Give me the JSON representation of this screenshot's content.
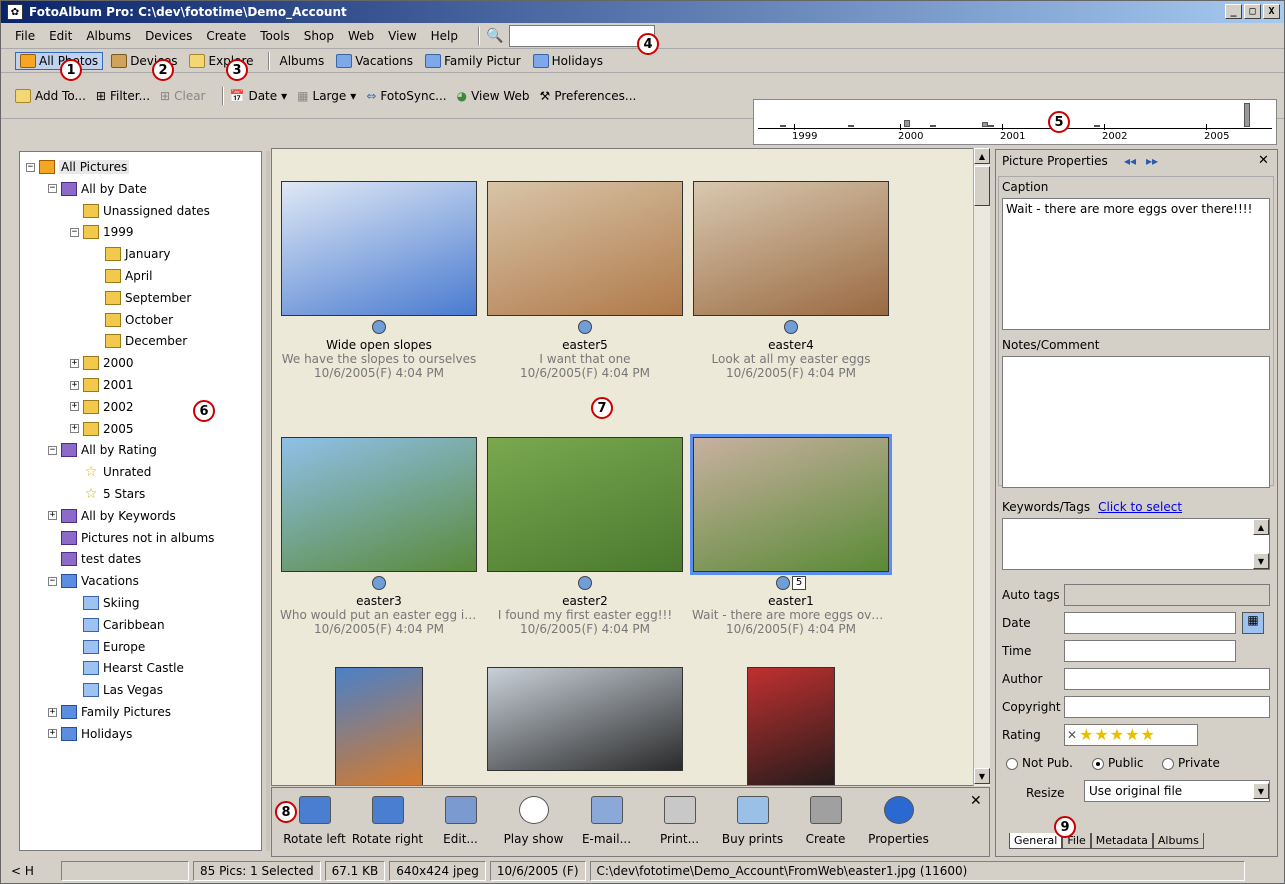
{
  "window": {
    "title": "FotoAlbum Pro:  C:\\dev\\fototime\\Demo_Account",
    "minimize": "_",
    "maximize": "□",
    "close": "X"
  },
  "menu": [
    "File",
    "Edit",
    "Albums",
    "Devices",
    "Create",
    "Tools",
    "Shop",
    "Web",
    "View",
    "Help"
  ],
  "search": {
    "value": "",
    "placeholder": ""
  },
  "nav": {
    "all_photos": "All Photos",
    "devices": "Devices",
    "explore": "Explore",
    "albums": "Albums",
    "vacations": "Vacations",
    "family": "Family Pictur",
    "holidays": "Holidays"
  },
  "toolbar": {
    "add_to": "Add To...",
    "filter": "Filter...",
    "clear": "Clear",
    "date": "Date",
    "large": "Large",
    "fotosync": "FotoSync...",
    "view_web": "View Web",
    "preferences": "Preferences..."
  },
  "timeline": {
    "years": [
      "1999",
      "2000",
      "2001",
      "2002",
      "2005"
    ],
    "bar_levels": [
      0.1,
      0.1,
      0.3,
      0.1,
      0.2,
      0.1,
      0.1,
      1.0
    ]
  },
  "tree": {
    "root": "All Pictures",
    "by_date": "All by Date",
    "unassigned": "Unassigned dates",
    "y1999": "1999",
    "months": [
      "January",
      "April",
      "September",
      "October",
      "December"
    ],
    "y2000": "2000",
    "y2001": "2001",
    "y2002": "2002",
    "y2005": "2005",
    "by_rating": "All by Rating",
    "unrated": "Unrated",
    "five_stars": "5 Stars",
    "by_keywords": "All by Keywords",
    "not_in_albums": "Pictures not in albums",
    "test_dates": "test dates",
    "vacations": "Vacations",
    "vacation_items": [
      "Skiing",
      "Caribbean",
      "Europe",
      "Hearst Castle",
      "Las Vegas"
    ],
    "family": "Family Pictures",
    "holidays": "Holidays"
  },
  "photos": [
    {
      "caption": "Wide open slopes",
      "desc": "We have the slopes to ourselves",
      "date": "10/6/2005(F)  4:04 PM",
      "colors": [
        "#4a7bd0",
        "#dfe8f5"
      ]
    },
    {
      "caption": "easter5",
      "desc": "I want that one",
      "date": "10/6/2005(F)  4:04 PM",
      "colors": [
        "#b07a4a",
        "#d8c4a8"
      ]
    },
    {
      "caption": "easter4",
      "desc": "Look at all my easter eggs",
      "date": "10/6/2005(F)  4:04 PM",
      "colors": [
        "#9a6a42",
        "#d8c8b0"
      ]
    },
    {
      "caption": "easter3",
      "desc": "Who would put an easter egg in ...",
      "date": "10/6/2005(F)  4:04 PM",
      "colors": [
        "#5a8a3a",
        "#8fc0e8"
      ]
    },
    {
      "caption": "easter2",
      "desc": "I found my first easter egg!!!",
      "date": "10/6/2005(F)  4:04 PM",
      "colors": [
        "#4a7a2e",
        "#7aa850"
      ]
    },
    {
      "caption": "easter1",
      "desc": "Wait - there are more eggs over t...",
      "date": "10/6/2005(F)  4:04 PM",
      "colors": [
        "#5a8a36",
        "#c8b0a0"
      ]
    },
    {
      "caption": "",
      "desc": "",
      "date": "",
      "colors": [
        "#e07a20",
        "#4a80c8"
      ]
    },
    {
      "caption": "",
      "desc": "",
      "date": "",
      "colors": [
        "#2a2a2a",
        "#c8d0d8"
      ]
    },
    {
      "caption": "",
      "desc": "",
      "date": "",
      "colors": [
        "#1a1a1a",
        "#c03030"
      ]
    }
  ],
  "easter1_rating": "5",
  "tasks": [
    "Rotate left",
    "Rotate right",
    "Edit...",
    "Play show",
    "E-mail...",
    "Print...",
    "Buy prints",
    "Create",
    "Properties"
  ],
  "props": {
    "title": "Picture Properties",
    "caption_label": "Caption",
    "caption_value": "Wait - there are more eggs over there!!!!",
    "notes_label": "Notes/Comment",
    "keywords_label": "Keywords/Tags",
    "keywords_link": "Click to select",
    "auto_tags": "Auto tags",
    "date": "Date",
    "time": "Time",
    "author": "Author",
    "copyright": "Copyright",
    "rating": "Rating",
    "rating_value": 5,
    "not_pub": "Not Pub.",
    "public": "Public",
    "private": "Private",
    "resize": "Resize",
    "resize_value": "Use original file",
    "tabs": [
      "General",
      "File",
      "Metadata",
      "Albums"
    ]
  },
  "status": {
    "nav": "< H",
    "count": "85 Pics: 1 Selected",
    "size": "67.1 KB",
    "dims": "640x424 jpeg",
    "date": "10/6/2005 (F)",
    "path": "C:\\dev\\fototime\\Demo_Account\\FromWeb\\easter1.jpg (11600)"
  },
  "callouts": [
    "1",
    "2",
    "3",
    "4",
    "5",
    "6",
    "7",
    "8",
    "9"
  ],
  "colors": {
    "accent": "#316ac5",
    "title_start": "#0a246a",
    "title_end": "#a6caf0",
    "callout": "#cc0000"
  }
}
